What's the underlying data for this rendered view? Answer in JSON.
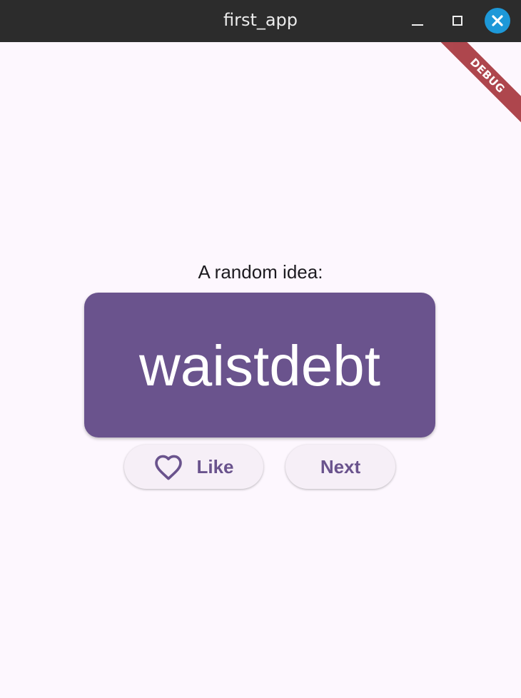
{
  "window": {
    "title": "first_app",
    "controls": {
      "minimize_icon": "minimize-icon",
      "maximize_icon": "maximize-icon",
      "close_icon": "close-icon",
      "close_color": "#1d98d8"
    }
  },
  "debug_banner": {
    "label": "DEBUG",
    "color": "#a8373f"
  },
  "main": {
    "prompt": "A random idea:",
    "word": "waistdebt",
    "card_color": "#6a538d",
    "background": "#fdf7fe"
  },
  "actions": {
    "like_label": "Like",
    "like_icon": "heart-outline-icon",
    "next_label": "Next"
  }
}
